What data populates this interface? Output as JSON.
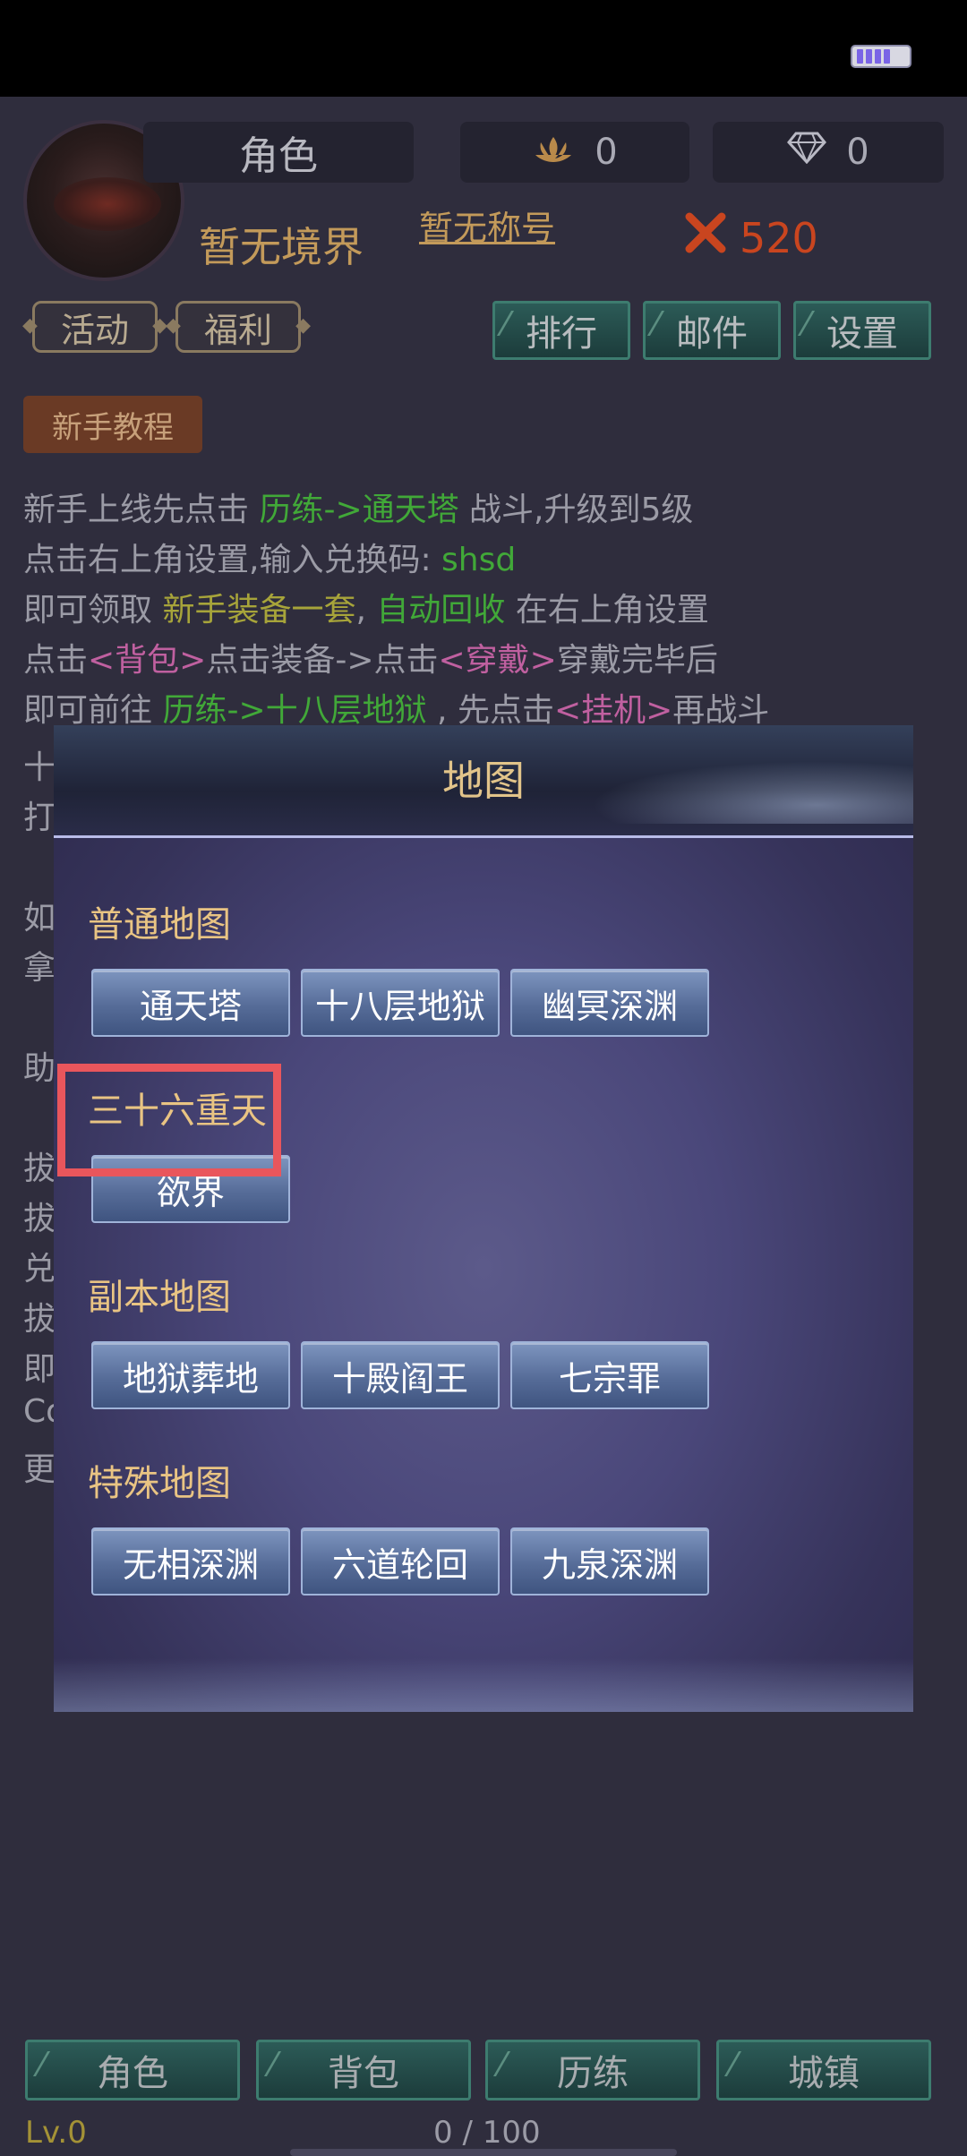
{
  "header": {
    "role_name": "角色",
    "lotus_count": "0",
    "gem_count": "0",
    "realm": "暂无境界",
    "title": "暂无称号",
    "power": "520"
  },
  "top_buttons": {
    "activity": "活动",
    "welfare": "福利",
    "rank": "排行",
    "mail": "邮件",
    "settings": "设置"
  },
  "tutorial": {
    "tab": "新手教程",
    "lines": [
      [
        {
          "t": "新手上线先点击 ",
          "c": ""
        },
        {
          "t": "历练->通天塔",
          "c": "g"
        },
        {
          "t": " 战斗,升级到5级",
          "c": ""
        }
      ],
      [
        {
          "t": "点击右上角设置,输入兑换码: ",
          "c": ""
        },
        {
          "t": "shsd",
          "c": "g"
        }
      ],
      [
        {
          "t": "即可领取 ",
          "c": ""
        },
        {
          "t": "新手装备一套",
          "c": "y"
        },
        {
          "t": ", ",
          "c": ""
        },
        {
          "t": "自动回收",
          "c": "g"
        },
        {
          "t": " 在右上角设置",
          "c": ""
        }
      ],
      [
        {
          "t": "点击",
          "c": ""
        },
        {
          "t": "<背包>",
          "c": "p"
        },
        {
          "t": "点击装备->点击",
          "c": ""
        },
        {
          "t": "<穿戴>",
          "c": "p"
        },
        {
          "t": "穿戴完毕后",
          "c": ""
        }
      ],
      [
        {
          "t": "即可前往 ",
          "c": ""
        },
        {
          "t": "历练->十八层地狱",
          "c": "g"
        },
        {
          "t": " , 先点击",
          "c": ""
        },
        {
          "t": "<挂机>",
          "c": "p"
        },
        {
          "t": "再战斗",
          "c": ""
        }
      ]
    ],
    "side_fragments": [
      "十",
      "打",
      "如",
      "拿",
      "助",
      "拔",
      "拔",
      "兑",
      "拔",
      "即",
      "Co",
      "更"
    ]
  },
  "map_modal": {
    "title": "地图",
    "sections": [
      {
        "label": "普通地图",
        "buttons": [
          "通天塔",
          "十八层地狱",
          "幽冥深渊"
        ]
      },
      {
        "label": "三十六重天",
        "buttons": [
          "欲界"
        ]
      },
      {
        "label": "副本地图",
        "buttons": [
          "地狱葬地",
          "十殿阎王",
          "七宗罪"
        ]
      },
      {
        "label": "特殊地图",
        "buttons": [
          "无相深渊",
          "六道轮回",
          "九泉深渊"
        ]
      }
    ]
  },
  "bottom_nav": {
    "items": [
      "角色",
      "背包",
      "历练",
      "城镇"
    ],
    "level": "Lv.0",
    "progress": "0 / 100"
  },
  "colors": {
    "accent_gold": "#e9c483",
    "tutorial_green": "#41a838",
    "highlight_red": "#e9565c"
  }
}
